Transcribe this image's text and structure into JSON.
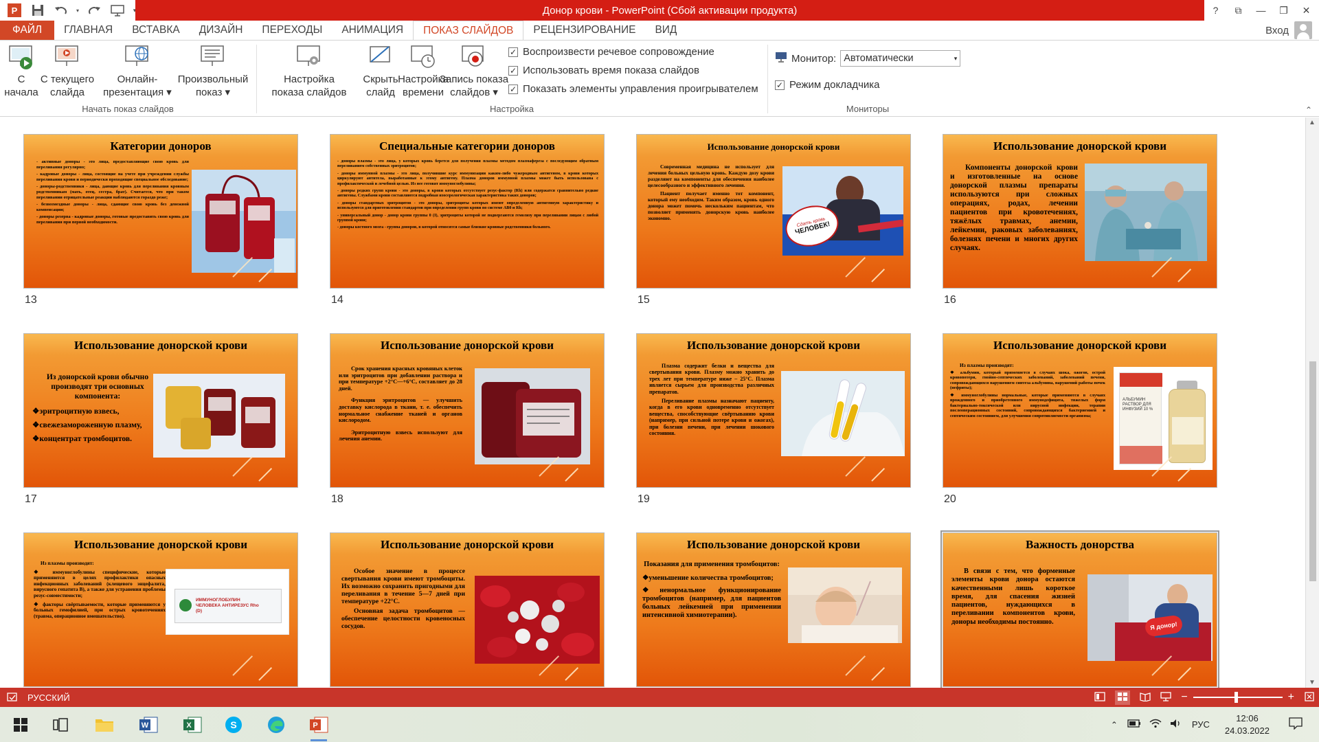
{
  "window": {
    "title": "Донор крови -  PowerPoint (Сбой активации продукта)",
    "controls": {
      "help": "?",
      "ribbon_display": "⧉",
      "minimize": "—",
      "restore": "❐",
      "close": "✕"
    }
  },
  "tabs": [
    {
      "label": "ФАЙЛ"
    },
    {
      "label": "ГЛАВНАЯ"
    },
    {
      "label": "ВСТАВКА"
    },
    {
      "label": "ДИЗАЙН"
    },
    {
      "label": "ПЕРЕХОДЫ"
    },
    {
      "label": "АНИМАЦИЯ"
    },
    {
      "label": "ПОКАЗ СЛАЙДОВ"
    },
    {
      "label": "РЕЦЕНЗИРОВАНИЕ"
    },
    {
      "label": "ВИД"
    }
  ],
  "signin_label": "Вход",
  "ribbon": {
    "start_group": {
      "label": "Начать показ слайдов",
      "buttons": [
        {
          "line1": "С",
          "line2": "начала"
        },
        {
          "line1": "С текущего",
          "line2": "слайда"
        },
        {
          "line1": "Онлайн-",
          "line2": "презентация ▾"
        },
        {
          "line1": "Произвольный",
          "line2": "показ ▾"
        }
      ]
    },
    "setup_group": {
      "label": "Настройка",
      "buttons": [
        {
          "line1": "Настройка",
          "line2": "показа слайдов"
        },
        {
          "line1": "Скрыть",
          "line2": "слайд"
        },
        {
          "line1": "Настройка",
          "line2": "времени"
        },
        {
          "line1": "Запись показа",
          "line2": "слайдов ▾"
        }
      ],
      "checkboxes": [
        {
          "label": "Воспроизвести речевое сопровождение",
          "mark": "✓"
        },
        {
          "label": "Использовать время показа слайдов",
          "mark": "✓"
        },
        {
          "label": "Показать элементы управления проигрывателем",
          "mark": "✓"
        }
      ]
    },
    "monitors_group": {
      "label": "Мониторы",
      "monitor_label": "Монитор:",
      "monitor_value": "Автоматически",
      "presenter_label": "Режим докладчика",
      "presenter_mark": "✓"
    }
  },
  "slides": [
    {
      "number": "13",
      "title": "Категории доноров",
      "paragraphs": [
        "- активные доноры - это лица, предоставляющие свою кровь для переливания регулярно;",
        "- кадровые доноры - лица, состоящие на учете при учреждении службы переливания крови и периодически проходящие специальное обследование;",
        "- доноры-родственники - лица, дающие кровь для переливания кровным родственникам (мать, отец, сестра, брат). Считается, что при таком переливании отрицательные реакции наблюдаются гораздо реже;",
        "- безвозмездные доноры - лица, сдающие свою кровь без денежной компенсации;",
        "- доноры резерва - кадровые доноры, готовые предоставить свою кровь для переливания при первой необходимости."
      ]
    },
    {
      "number": "14",
      "title": "Специальные категории доноров",
      "paragraphs": [
        "- доноры плазмы - это лица, у которых кровь берется для получения плазмы методом плазмафереза с последующим обратным переливанием собственных эритроцитов;",
        "- доноры иммунной плазмы - это лица, получившие курс иммунизации каким-либо чужеродным антигеном, в крови которых циркулируют антитела, выработанные к этому антигену. Плазма доноров иммунной плазмы может быть использована с профилактической и лечебной целью. Из нее готовят иммуноглобулины;",
        "- доноры редких групп крови - это доноры, в крови которых отсутствует резус-фактор (Rh) или содержатся сравнительно редкие антигены. Службами крови составляются подробная изосерологическая характеристика таких доноров;",
        "- доноры стандартных эритроцитов - это доноры, эритроциты которых имеют определенную антигенную характеристику и используются для приготовления стандартов при определении групп крови по системе АВ0 и Rh;",
        "- универсальный донор - донор крови группы 0 (I), эритроциты которой не подвергаются гемолизу при переливании лицам с любой группой крови;",
        "- доноры костного мозга - группа доноров, в которой относятся самые близкие кровные родственники больного."
      ]
    },
    {
      "number": "15",
      "title": "Использование донорской крови",
      "paragraphs": [
        "Современная медицина не использует для лечения больных цельную кровь. Каждую дозу крови разделяют на компоненты для обеспечения наиболее целесообразного и эффективного лечения.",
        "Пациент получает именно тот компонент, который ему необходим. Таким образом, кровь одного донора может помочь нескольким пациентам, что позволяет применять донорскую кровь наиболее экономно."
      ],
      "picture_sign": "ЧЕЛОВЕК!",
      "picture_sign_top": "Сдать кровь"
    },
    {
      "number": "16",
      "title": "Использование донорской крови",
      "paragraphs": [
        "Компоненты донорской крови и изготовленные на основе донорской плазмы препараты используются при сложных операциях, родах, лечении пациентов при кровотечениях, тяжёлых травмах, анемии, лейкемии, раковых заболеваниях, болезнях печени и многих других случаях."
      ]
    },
    {
      "number": "17",
      "title": "Использование донорской крови",
      "intro": "Из донорской крови обычно производят три основных компонента:",
      "bullets": [
        "эритроцитную взвесь,",
        "свежезамороженную плазму,",
        "концентрат тромбоцитов."
      ]
    },
    {
      "number": "18",
      "title": "Использование донорской крови",
      "paragraphs": [
        "Срок хранения красных кровяных клеток или эритроцитов при добавлении раствора и при температуре +2°С—+6°С, составляет до 28 дней.",
        "Функция эритроцитов — улучшить доставку кислорода в ткани, т. е. обеспечить нормальное снабжение тканей и органов кислородом.",
        "Эритроцитную взвесь используют для лечения анемии."
      ]
    },
    {
      "number": "19",
      "title": "Использование донорской крови",
      "paragraphs": [
        "Плазма содержит белки и вещества для свертывания крови. Плазму можно хранить до трех лет при температуре ниже – 25°С. Плазма является сырьем для производства различных препаратов.",
        "Переливание плазмы назначают пациенту, когда в его крови одновременно отсутствует вещества, способствующие свёртыванию крови (например, при сильной потере крови и ожогах), при болезни печени, при лечении шокового состояния."
      ]
    },
    {
      "number": "20",
      "title": "Использование донорской крови",
      "intro": "Из плазмы производят:",
      "bullets": [
        "альбумин, который применяется в случаях шока, ожогов, острой кровопотери, гнойно-септических заболеваний, заболеваний печени, сопровождающихся нарушением синтеза альбумина, нарушений работы почек (нефриты);",
        "иммуноглобулины нормальные, которые применяются в случаях врожденного и приобретенного иммунодефицита, тяжелых форм бактериально-токсической или вирусной инфекции, терапии послеоперационных состояний, сопровождающихся бактериемией и септическим состоянием, для улучшения сопротивляемости организма;"
      ],
      "picture_label": "АЛЬБУМИН РАСТВОР ДЛЯ ИНФУЗИЙ 10 %"
    },
    {
      "number": "21",
      "title": "Использование донорской крови",
      "intro": "Из плазмы производят:",
      "bullets": [
        "иммуноглобулины специфические, которые применяются в целях профилактики опасных инфекционных заболеваний (клещевого энцефалита, вирусного гепатита В), а также для устранения проблемы резус-совместимости;",
        "факторы свёртываемости, которые применяются у больных гемофилией, при острых кровотечениях (травма, операционное вмешательство)."
      ],
      "picture_label": "ИММУНОГЛОБУЛИН ЧЕЛОВЕКА АНТИРЕЗУС Rho (D)"
    },
    {
      "number": "22",
      "title": "Использование донорской крови",
      "paragraphs": [
        "Особое значение в процессе свертывания крови имеют тромбоциты. Их возможно сохранить пригодными для переливания в течение 5—7 дней при температуре +22°С.",
        "Основная задача тромбоцитов — обеспечение целостности кровеносных сосудов."
      ]
    },
    {
      "number": "23",
      "title": "Использование донорской крови",
      "intro": "Показания для применения тромбоцитов:",
      "bullets": [
        "уменьшение количества тромбоцитов;",
        "ненормальное функционирование тромбоцитов (например, для пациентов больных лейкемией при применении интенсивной химиотерапии)."
      ]
    },
    {
      "number": "24",
      "title": "Важность донорства",
      "paragraphs": [
        "В связи с тем, что форменные элементы крови донора остаются качественными лишь короткое время, для спасения жизней пациентов, нуждающихся в переливании компонентов крови, доноры необходимы постоянно."
      ],
      "picture_sign": "Я донор!"
    }
  ],
  "status": {
    "language": "РУССКИЙ",
    "zoom_minus": "−",
    "zoom_plus": "+"
  },
  "taskbar": {
    "lang": "РУС",
    "time": "12:06",
    "date": "24.03.2022"
  },
  "colors": {
    "app_accent": "#d24726",
    "title_bar": "#d41e14",
    "status_bar": "#c8352a",
    "slide_orange": "#ee7a1b"
  }
}
